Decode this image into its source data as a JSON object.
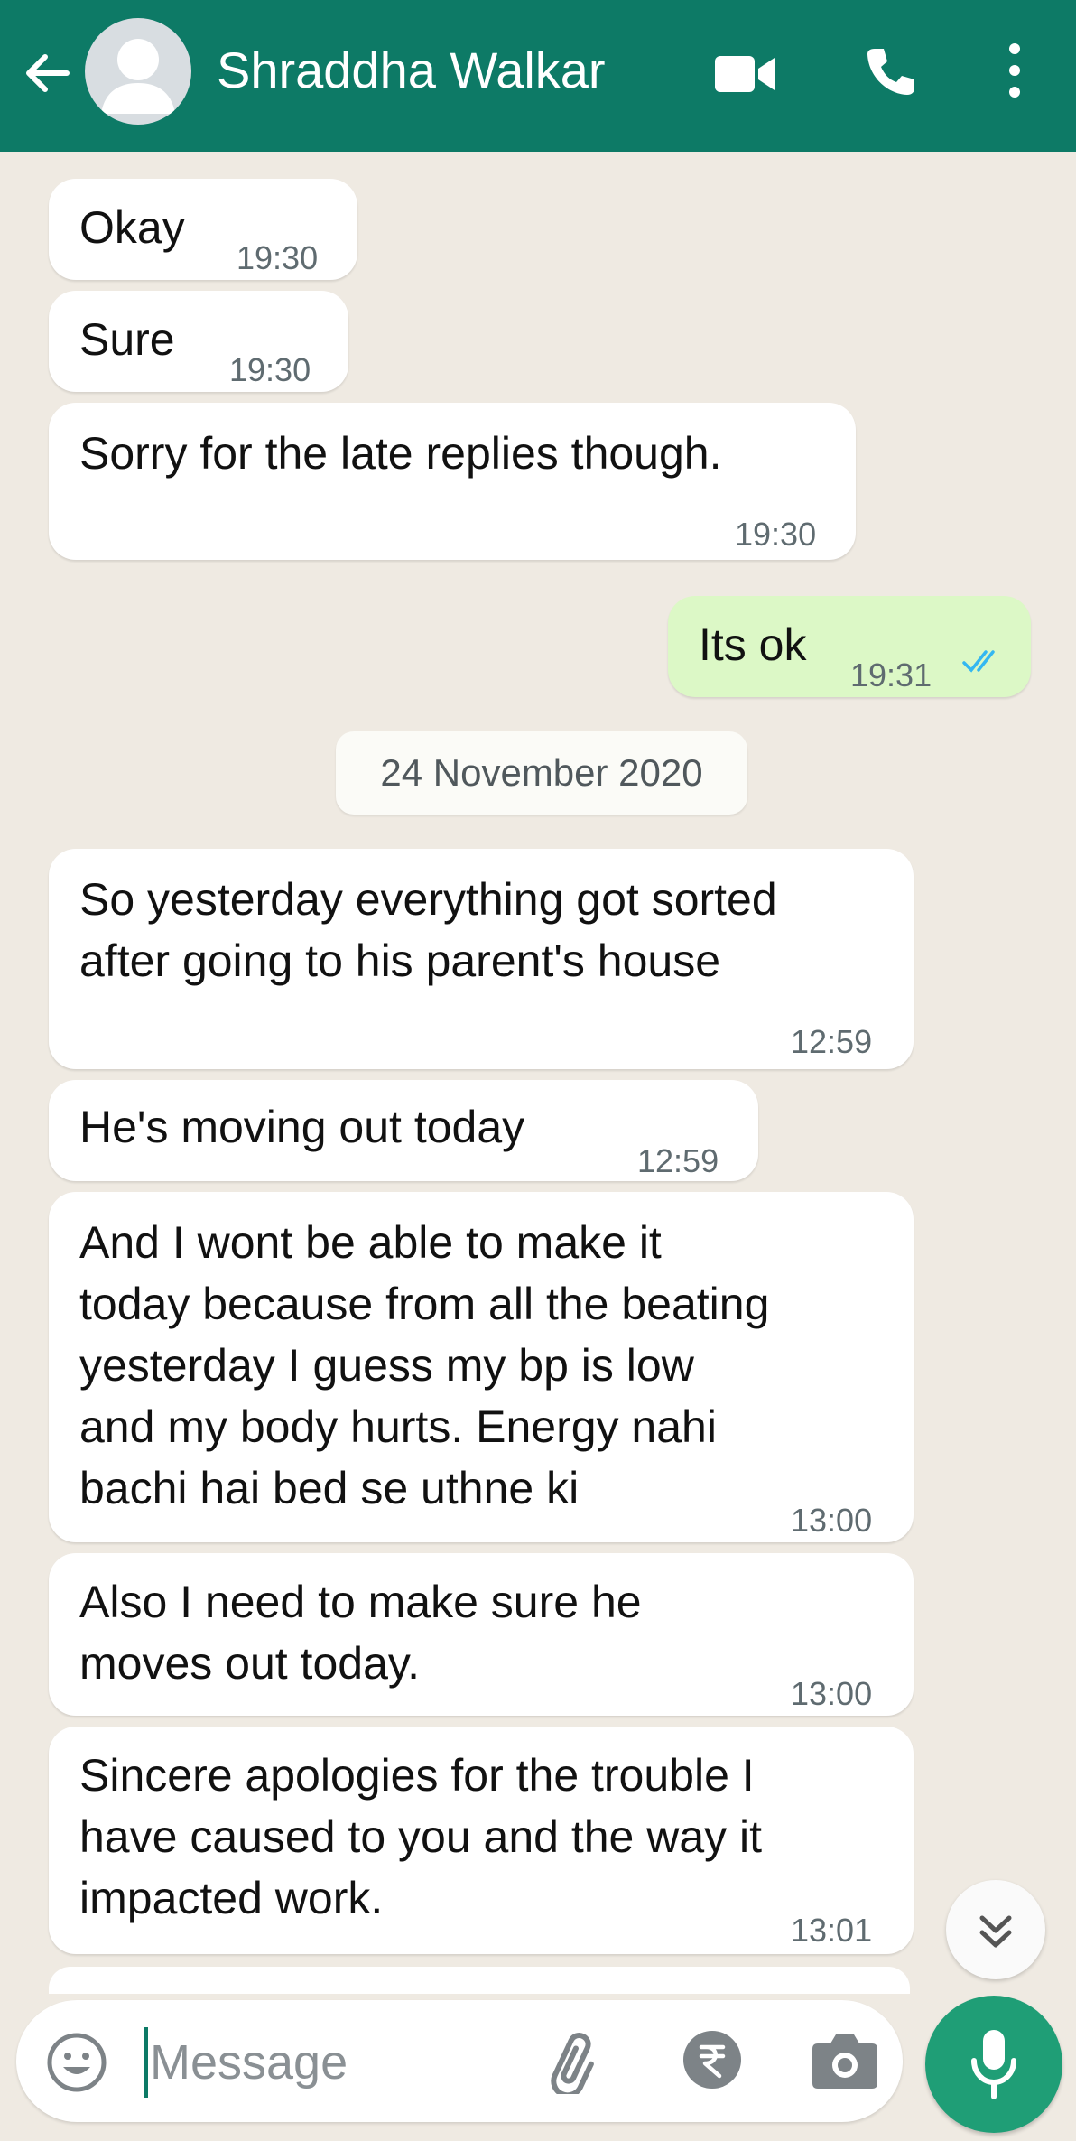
{
  "header": {
    "contact_name": "Shraddha Walkar",
    "background_color": "#0d7a66"
  },
  "messages": [
    {
      "direction": "in",
      "text": "Okay",
      "time": "19:30"
    },
    {
      "direction": "in",
      "text": "Sure",
      "time": "19:30"
    },
    {
      "direction": "in",
      "text": "Sorry for the late replies though.",
      "time": "19:30"
    },
    {
      "direction": "out",
      "text": "Its ok",
      "time": "19:31",
      "status": "read"
    },
    {
      "direction": "in",
      "text_lines": [
        "So yesterday everything got sorted",
        "after going to his parent's house"
      ],
      "time": "12:59"
    },
    {
      "direction": "in",
      "text": "He's moving out today",
      "time": "12:59"
    },
    {
      "direction": "in",
      "text_lines": [
        "And I wont be able to make it",
        "today because from all the beating",
        "yesterday I guess my bp is low",
        "and my body hurts. Energy nahi",
        "bachi hai bed se uthne ki"
      ],
      "time": "13:00"
    },
    {
      "direction": "in",
      "text_lines": [
        "Also I need to make sure he",
        "moves out today."
      ],
      "time": "13:00"
    },
    {
      "direction": "in",
      "text_lines": [
        "Sincere apologies for the trouble I",
        "have caused to you and the way it",
        "impacted work."
      ],
      "time": "13:01"
    }
  ],
  "date_divider": "24 November 2020",
  "composer": {
    "placeholder": "Message",
    "icons": [
      "emoji-icon",
      "attachment-icon",
      "rupee-icon",
      "camera-icon",
      "microphone-icon"
    ],
    "mic_color": "#1f9e76"
  },
  "colors": {
    "chat_background": "#efeae2",
    "incoming_bubble": "#ffffff",
    "outgoing_bubble": "#dcf8c6",
    "read_ticks": "#34b7f1"
  }
}
